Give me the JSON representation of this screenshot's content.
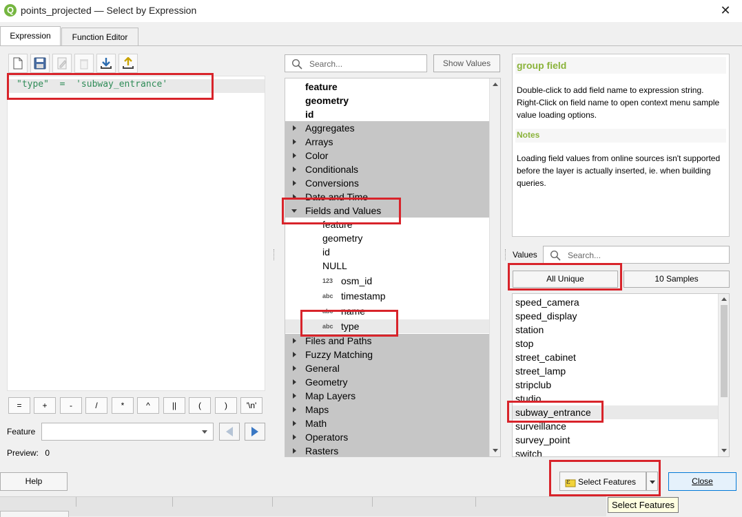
{
  "window": {
    "title": "points_projected — Select by Expression"
  },
  "tabs": [
    {
      "label": "Expression"
    },
    {
      "label": "Function Editor"
    }
  ],
  "expression": {
    "text": "\"type\"  =  'subway_entrance'"
  },
  "operators": [
    "=",
    "+",
    "-",
    "/",
    "*",
    "^",
    "||",
    "(",
    ")",
    "'\\n'"
  ],
  "feature": {
    "label": "Feature",
    "value": ""
  },
  "preview": {
    "label": "Preview:",
    "value": "0"
  },
  "search": {
    "placeholder": "Search..."
  },
  "show_values_label": "Show Values",
  "tree": {
    "top_items": [
      "feature",
      "geometry",
      "id"
    ],
    "groups_before": [
      "Aggregates",
      "Arrays",
      "Color",
      "Conditionals",
      "Conversions",
      "Date and Time"
    ],
    "fields_group": "Fields and Values",
    "fields": [
      {
        "name": "feature",
        "type": ""
      },
      {
        "name": "geometry",
        "type": ""
      },
      {
        "name": "id",
        "type": ""
      },
      {
        "name": "NULL",
        "type": ""
      },
      {
        "name": "osm_id",
        "type": "123"
      },
      {
        "name": "timestamp",
        "type": "abc"
      },
      {
        "name": "name",
        "type": "abc"
      },
      {
        "name": "type",
        "type": "abc"
      }
    ],
    "groups_after": [
      "Files and Paths",
      "Fuzzy Matching",
      "General",
      "Geometry",
      "Map Layers",
      "Maps",
      "Math",
      "Operators",
      "Rasters"
    ]
  },
  "help": {
    "title": "group field",
    "body": "Double-click to add field name to expression string. Right-Click on field name to open context menu sample value loading options.",
    "notes_title": "Notes",
    "notes_body": "Loading field values from online sources isn't supported before the layer is actually inserted, ie. when building queries."
  },
  "values": {
    "label": "Values",
    "search_placeholder": "Search...",
    "all_unique_label": "All Unique",
    "samples_label": "10 Samples",
    "items": [
      "speed_camera",
      "speed_display",
      "station",
      "stop",
      "street_cabinet",
      "street_lamp",
      "stripclub",
      "studio",
      "subway_entrance",
      "surveillance",
      "survey_point",
      "switch"
    ],
    "selected": "subway_entrance"
  },
  "footer": {
    "help_label": "Help",
    "select_features_label": "Select Features",
    "close_label": "Close",
    "tooltip": "Select Features"
  },
  "colors": {
    "highlight": "#d8232a",
    "help_title": "#8ab33a",
    "tree_group_bg": "#c6c6c6"
  }
}
